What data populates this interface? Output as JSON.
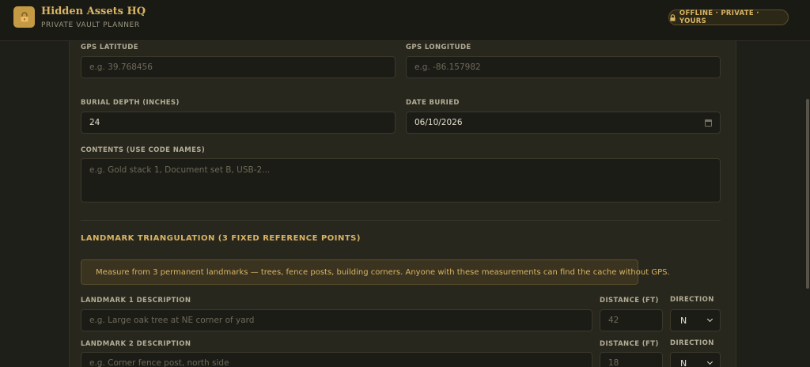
{
  "header": {
    "title": "Hidden Assets HQ",
    "subtitle": "PRIVATE VAULT PLANNER",
    "logo_icon": "lock-icon",
    "badge": {
      "icon": "lock-icon",
      "label": "OFFLINE · PRIVATE · YOURS"
    }
  },
  "form": {
    "gps_latitude": {
      "label": "GPS LATITUDE",
      "value": "",
      "placeholder": "e.g. 39.768456"
    },
    "gps_longitude": {
      "label": "GPS LONGITUDE",
      "value": "",
      "placeholder": "e.g. -86.157982"
    },
    "burial_depth": {
      "label": "BURIAL DEPTH (INCHES)",
      "value": "24"
    },
    "date_buried": {
      "label": "DATE BURIED",
      "value": "06/10/2026",
      "icon": "calendar-icon"
    },
    "contents": {
      "label": "CONTENTS (USE CODE NAMES)",
      "value": "",
      "placeholder": "e.g. Gold stack 1, Document set B, USB-2..."
    }
  },
  "landmarks": {
    "section_title": "LANDMARK TRIANGULATION (3 FIXED REFERENCE POINTS)",
    "notice": {
      "icon": "ruler-triangle-icon",
      "text": "Measure from 3 permanent landmarks — trees, fence posts, building corners. Anyone with these measurements can find the cache without GPS."
    },
    "distance_label": "DISTANCE (FT)",
    "direction_label": "DIRECTION",
    "items": [
      {
        "label": "LANDMARK 1 DESCRIPTION",
        "placeholder": "e.g. Large oak tree at NE corner of yard",
        "distance_placeholder": "42",
        "direction": "N"
      },
      {
        "label": "LANDMARK 2 DESCRIPTION",
        "placeholder": "e.g. Corner fence post, north side",
        "distance_placeholder": "18",
        "direction": "N"
      }
    ]
  },
  "colors": {
    "accent": "#d9b463",
    "background": "#1f1f19",
    "panel": "#28271e",
    "field": "#1c1c17"
  }
}
